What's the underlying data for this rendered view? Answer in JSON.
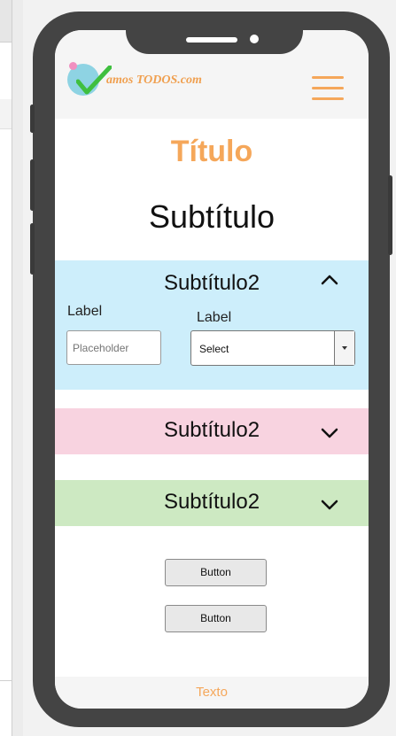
{
  "header": {
    "logo_text": "amos TODOS.com",
    "menu_icon": "hamburger-menu-icon"
  },
  "title": "Título",
  "subtitle": "Subtítulo",
  "accordions": [
    {
      "title": "Subtítulo2",
      "expanded": true,
      "color": "#cdeefb",
      "fields": {
        "input_label": "Label",
        "input_placeholder": "Placeholder",
        "select_label": "Label",
        "select_value": "Select"
      }
    },
    {
      "title": "Subtítulo2",
      "expanded": false,
      "color": "#f8d3e0"
    },
    {
      "title": "Subtítulo2",
      "expanded": false,
      "color": "#cde9c2"
    }
  ],
  "buttons": [
    "Button",
    "Button"
  ],
  "footer": "Texto",
  "colors": {
    "accent": "#f5a75a",
    "phone_frame": "#444444"
  }
}
